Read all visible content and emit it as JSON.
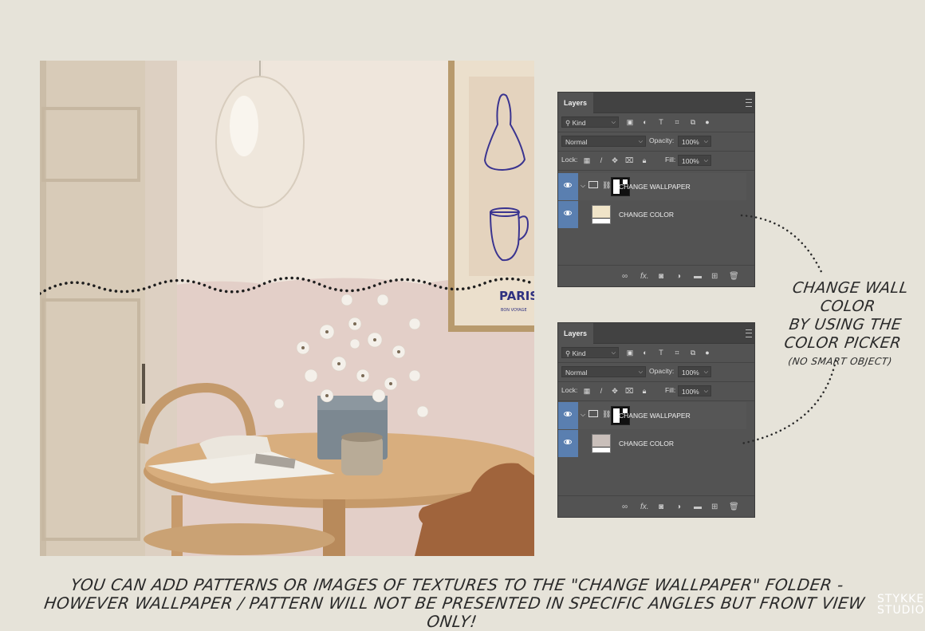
{
  "colors": {
    "background": "#e6e3d9",
    "panel": "#535353",
    "layer_selected": "#5a7fb0",
    "wallpaper_swatch_1": "#f0e4c8",
    "wallpaper_swatch_2": "#c9bfba"
  },
  "panel_top": {
    "tab_title": "Layers",
    "filter": "Kind",
    "blend_mode": "Normal",
    "opacity_label": "Opacity:",
    "opacity_value": "100%",
    "lock_label": "Lock:",
    "fill_label": "Fill:",
    "fill_value": "100%",
    "layers": [
      {
        "name": "CHANGE WALLPAPER"
      },
      {
        "name": "CHANGE COLOR"
      }
    ]
  },
  "panel_bottom": {
    "tab_title": "Layers",
    "filter": "Kind",
    "blend_mode": "Normal",
    "opacity_label": "Opacity:",
    "opacity_value": "100%",
    "lock_label": "Lock:",
    "fill_label": "Fill:",
    "fill_value": "100%",
    "layers": [
      {
        "name": "CHANGE WALLPAPER"
      },
      {
        "name": "CHANGE COLOR"
      }
    ]
  },
  "annotation": {
    "line1": "CHANGE WALL COLOR",
    "line2": "BY USING THE",
    "line3": "COLOR PICKER",
    "line4": "(NO SMART OBJECT)"
  },
  "poster_text": {
    "title": "PARIS",
    "subtitle": "BON VOYAGE"
  },
  "caption": {
    "line1": "YOU CAN ADD PATTERNS OR IMAGES OF TEXTURES TO THE \"CHANGE WALLPAPER\" FOLDER -",
    "line2": "HOWEVER WALLPAPER / PATTERN WILL NOT BE PRESENTED IN SPECIFIC ANGLES BUT FRONT VIEW ONLY!"
  },
  "brand": {
    "line1": "STYKKE",
    "line2": "STUDIO"
  }
}
